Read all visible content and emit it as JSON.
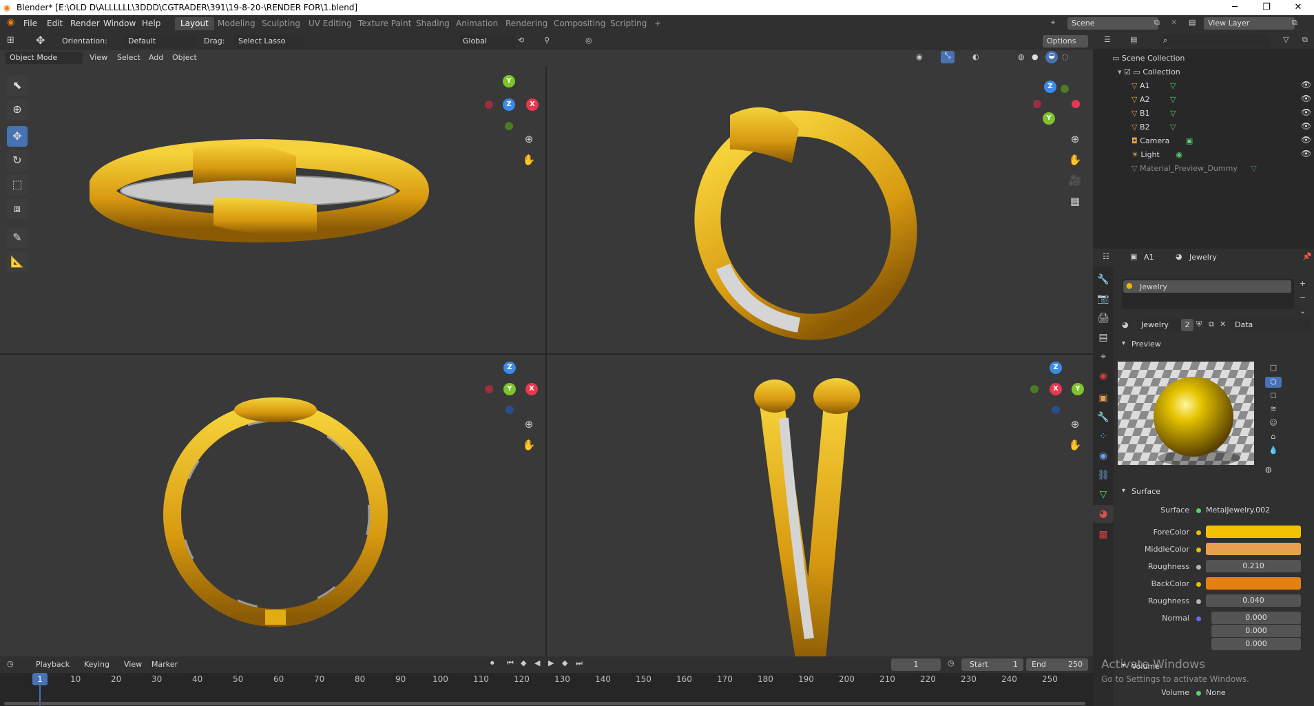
{
  "titlebar": {
    "title": "Blender* [E:\\OLD D\\ALLLLLL\\3DDD\\CGTRADER\\391\\19-8-20-\\RENDER FOR\\1.blend]",
    "minimize": "─",
    "maximize": "❐",
    "close": "✕"
  },
  "menu": [
    "File",
    "Edit",
    "Render",
    "Window",
    "Help"
  ],
  "workspaces": [
    "Layout",
    "Modeling",
    "Sculpting",
    "UV Editing",
    "Texture Paint",
    "Shading",
    "Animation",
    "Rendering",
    "Compositing",
    "Scripting"
  ],
  "workspace_add": "+",
  "scene": {
    "label": "Scene",
    "view_layer": "View Layer"
  },
  "tool_header": {
    "orientation_label": "Orientation:",
    "orientation_value": "Default",
    "drag_label": "Drag:",
    "drag_value": "Select Lasso",
    "transform_orientation": "Global",
    "options": "Options"
  },
  "viewport_header": {
    "mode": "Object Mode",
    "items": [
      "View",
      "Select",
      "Add",
      "Object"
    ]
  },
  "gizmo": {
    "x": "X",
    "y": "Y",
    "z": "Z"
  },
  "timeline": {
    "menus": [
      "Playback",
      "Keying",
      "View",
      "Marker"
    ],
    "current_frame": "1",
    "start_label": "Start",
    "start_value": "1",
    "end_label": "End",
    "end_value": "250",
    "ticks": [
      "10",
      "20",
      "30",
      "40",
      "50",
      "60",
      "70",
      "80",
      "90",
      "100",
      "110",
      "120",
      "130",
      "140",
      "150",
      "160",
      "170",
      "180",
      "190",
      "200",
      "210",
      "220",
      "230",
      "240",
      "250"
    ],
    "playhead": "1"
  },
  "outliner": {
    "root": "Scene Collection",
    "collection": "Collection",
    "items": [
      {
        "name": "A1"
      },
      {
        "name": "A2"
      },
      {
        "name": "B1"
      },
      {
        "name": "B2"
      },
      {
        "name": "Camera"
      },
      {
        "name": "Light"
      },
      {
        "name": "Material_Preview_Dummy"
      }
    ]
  },
  "properties": {
    "object_name": "A1",
    "material_name": "Jewelry",
    "slot_name": "Jewelry",
    "users": "2",
    "link": "Data",
    "preview_label": "Preview",
    "surface_label": "Surface",
    "surface_field_label": "Surface",
    "surface_value": "MetalJewelry.002",
    "rows": [
      {
        "label": "ForeColor",
        "type": "color",
        "color": "#f2c200"
      },
      {
        "label": "MiddleColor",
        "type": "color",
        "color": "#e8a04e"
      },
      {
        "label": "Roughness",
        "type": "number",
        "value": "0.210"
      },
      {
        "label": "BackColor",
        "type": "color",
        "color": "#e57f12"
      },
      {
        "label": "Roughness",
        "type": "number",
        "value": "0.040"
      }
    ],
    "normal_label": "Normal",
    "normal_values": [
      "0.000",
      "0.000",
      "0.000"
    ],
    "volume_label": "Volume",
    "volume_field_label": "Volume",
    "volume_value": "None"
  },
  "watermark": {
    "line1": "Activate Windows",
    "line2": "Go to Settings to activate Windows."
  },
  "colors": {
    "accent": "#4772b3",
    "gold": "#e6b800",
    "x_axis": "#e8384f",
    "y_axis": "#7ec42d",
    "z_axis": "#3b8be8"
  }
}
